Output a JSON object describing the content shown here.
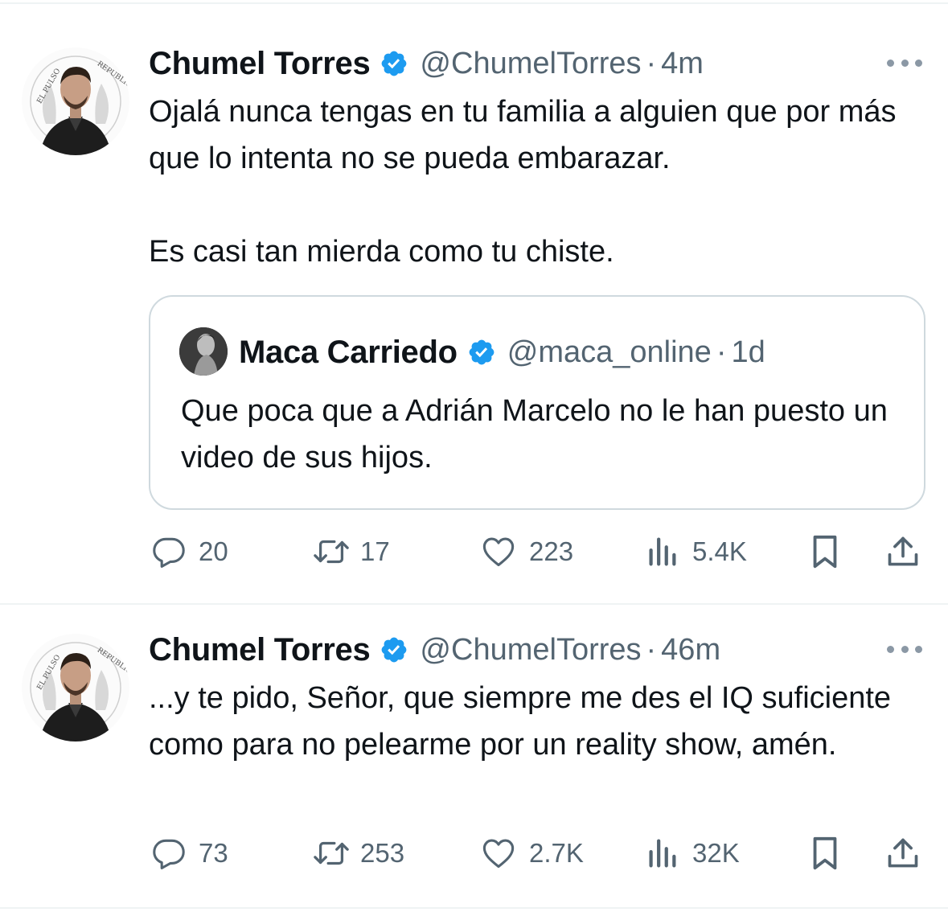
{
  "colors": {
    "text": "#0f1419",
    "secondary": "#536471",
    "verified_badge": "#1d9bf0",
    "border": "#cfd9de",
    "divider": "#eff3f4"
  },
  "tweets": [
    {
      "author_name": "Chumel Torres",
      "verified": true,
      "handle": "@ChumelTorres",
      "separator": "·",
      "time": "4m",
      "more_icon": "more-horizontal-icon",
      "text": "Ojalá nunca tengas en tu familia a alguien que por más que lo intenta no se pueda embarazar.\n\nEs casi tan mierda como tu chiste.",
      "quote": {
        "author_name": "Maca Carriedo",
        "verified": true,
        "handle": "@maca_online",
        "separator": "·",
        "time": "1d",
        "text": "Que poca que a Adrián Marcelo no le han puesto un video de sus hijos."
      },
      "actions": {
        "replies": "20",
        "retweets": "17",
        "likes": "223",
        "views": "5.4K",
        "icons": [
          "reply-icon",
          "retweet-icon",
          "like-icon",
          "views-icon",
          "bookmark-icon",
          "share-icon"
        ]
      }
    },
    {
      "author_name": "Chumel Torres",
      "verified": true,
      "handle": "@ChumelTorres",
      "separator": "·",
      "time": "46m",
      "more_icon": "more-horizontal-icon",
      "text": "...y te pido, Señor, que siempre me des el IQ suficiente como para no pelearme por un reality show, amén.",
      "actions": {
        "replies": "73",
        "retweets": "253",
        "likes": "2.7K",
        "views": "32K",
        "icons": [
          "reply-icon",
          "retweet-icon",
          "like-icon",
          "views-icon",
          "bookmark-icon",
          "share-icon"
        ]
      }
    }
  ]
}
